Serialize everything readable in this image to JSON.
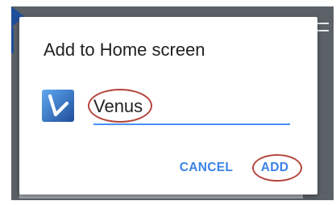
{
  "dialog": {
    "title": "Add to Home screen",
    "app_icon": "venus-app-icon",
    "name_field": {
      "value": "Venus",
      "placeholder": ""
    },
    "buttons": {
      "cancel_label": "CANCEL",
      "add_label": "ADD"
    }
  },
  "background": {
    "logo_icon": "app-logo-icon",
    "menu_icon": "hamburger-menu-icon"
  },
  "colors": {
    "accent": "#3b82e8",
    "underline": "#4a8ff5",
    "annotation_circle": "#b4463c",
    "scrim": "#5b6167",
    "app_icon_dark": "#1f4e9c",
    "app_icon_light": "#5fa8f0"
  }
}
